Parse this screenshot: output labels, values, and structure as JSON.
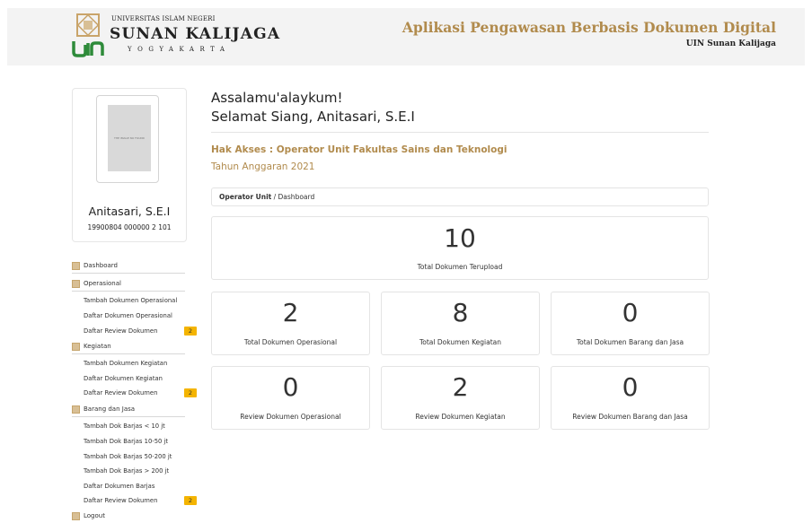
{
  "header": {
    "university_line1": "UNIVERSITAS ISLAM NEGERI",
    "university_line2": "SUNAN KALIJAGA",
    "university_line3": "YOGYAKARTA",
    "app_title": "Aplikasi Pengawasan Berbasis Dokumen Digital",
    "app_subtitle": "UIN Sunan Kalijaga"
  },
  "profile": {
    "photo_caption": "THE IMAGE NO FOUND",
    "name": "Anitasari, S.E.I",
    "nip": "19900804 000000 2 101"
  },
  "menu": {
    "dashboard": "Dashboard",
    "operasional": {
      "label": "Operasional",
      "items": [
        "Tambah Dokumen Operasional",
        "Daftar Dokumen Operasional",
        "Daftar Review Dokumen"
      ],
      "badge": "2"
    },
    "kegiatan": {
      "label": "Kegiatan",
      "items": [
        "Tambah Dokumen Kegiatan",
        "Daftar Dokumen Kegiatan",
        "Daftar Review Dokumen"
      ],
      "badge": "2"
    },
    "barjas": {
      "label": "Barang dan Jasa",
      "items": [
        "Tambah Dok Barjas < 10 jt",
        "Tambah Dok Barjas 10-50 jt",
        "Tambah Dok Barjas 50-200 jt",
        "Tambah Dok Barjas > 200 jt",
        "Daftar Dokumen Barjas",
        "Daftar Review Dokumen"
      ],
      "badge": "2"
    },
    "logout": "Logout"
  },
  "greeting": {
    "line1": "Assalamu'alaykum!",
    "line2": "Selamat Siang, Anitasari, S.E.I",
    "access": "Hak Akses : Operator Unit Fakultas Sains dan Teknologi",
    "year": "Tahun Anggaran 2021"
  },
  "breadcrumb": {
    "role": "Operator Unit",
    "separator": " / ",
    "page": "Dashboard"
  },
  "stats": {
    "total": {
      "value": "10",
      "label": "Total Dokumen Terupload"
    },
    "cards": [
      {
        "value": "2",
        "label": "Total Dokumen Operasional"
      },
      {
        "value": "8",
        "label": "Total Dokumen Kegiatan"
      },
      {
        "value": "0",
        "label": "Total Dokumen Barang dan Jasa"
      },
      {
        "value": "0",
        "label": "Review Dokumen Operasional"
      },
      {
        "value": "2",
        "label": "Review Dokumen Kegiatan"
      },
      {
        "value": "0",
        "label": "Review Dokumen Barang dan Jasa"
      }
    ]
  },
  "colors": {
    "gold": "#b18b4d",
    "badge": "#f4b400",
    "logo_green": "#2e8b3a",
    "header_bg": "#f3f3f3"
  }
}
